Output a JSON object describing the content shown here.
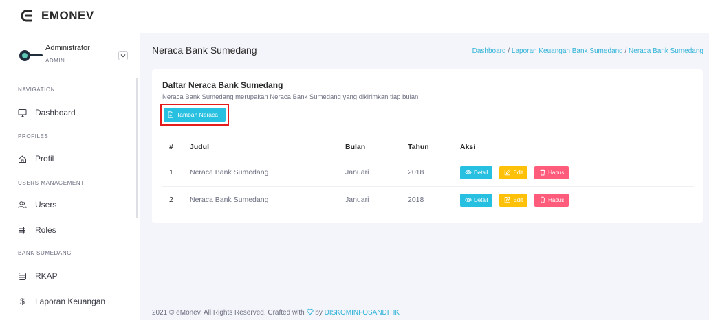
{
  "app": {
    "logo_text": "EMONEV"
  },
  "user": {
    "name": "Administrator",
    "role": "ADMIN"
  },
  "sidebar": {
    "sections": [
      {
        "heading": "NAVIGATION",
        "items": [
          {
            "label": "Dashboard",
            "icon": "monitor-icon"
          }
        ]
      },
      {
        "heading": "PROFILES",
        "items": [
          {
            "label": "Profil",
            "icon": "home-icon"
          }
        ]
      },
      {
        "heading": "USERS MANAGEMENT",
        "items": [
          {
            "label": "Users",
            "icon": "users-icon"
          },
          {
            "label": "Roles",
            "icon": "grid-icon"
          }
        ]
      },
      {
        "heading": "BANK SUMEDANG",
        "items": [
          {
            "label": "RKAP",
            "icon": "database-icon"
          },
          {
            "label": "Laporan Keuangan",
            "icon": "dollar-icon"
          }
        ]
      }
    ]
  },
  "header": {
    "title": "Neraca Bank Sumedang",
    "breadcrumb": {
      "items": [
        "Dashboard",
        "Laporan Keuangan Bank Sumedang",
        "Neraca Bank Sumedang"
      ],
      "separator": "/"
    }
  },
  "card": {
    "title": "Daftar Neraca Bank Sumedang",
    "description": "Neraca Bank Sumedang merupakan Neraca Bank Sumedang yang dikirimkan tiap bulan.",
    "add_button": "Tambah Neraca"
  },
  "table": {
    "columns": [
      "#",
      "Judul",
      "Bulan",
      "Tahun",
      "Aksi"
    ],
    "rows": [
      {
        "no": "1",
        "judul": "Neraca Bank Sumedang",
        "bulan": "Januari",
        "tahun": "2018"
      },
      {
        "no": "2",
        "judul": "Neraca Bank Sumedang",
        "bulan": "Januari",
        "tahun": "2018"
      }
    ],
    "actions": {
      "detail": "Detail",
      "edit": "Edit",
      "hapus": "Hapus"
    }
  },
  "footer": {
    "text": "2021 © eMonev. All Rights Reserved. Crafted with",
    "by": "by",
    "credit": "DISKOMINFOSANDITIK"
  },
  "colors": {
    "accent": "#28c0e0",
    "edit": "#ffc107",
    "delete": "#ff5c7c",
    "highlight": "#e41b1b"
  }
}
